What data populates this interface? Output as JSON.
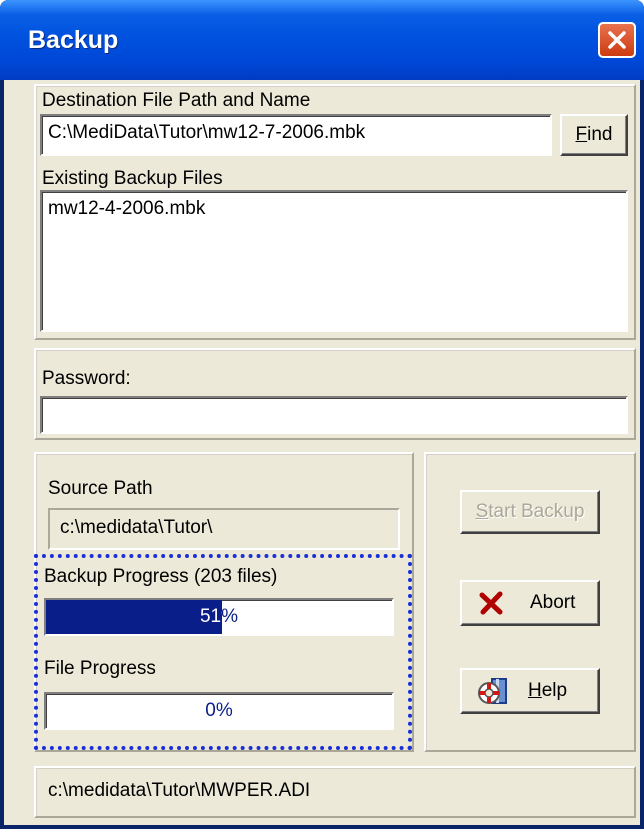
{
  "window": {
    "title": "Backup"
  },
  "destination": {
    "label": "Destination File Path and Name",
    "value": "C:\\MediData\\Tutor\\mw12-7-2006.mbk",
    "find_label_prefix": "",
    "find_hotkey": "F",
    "find_label_rest": "ind"
  },
  "existing": {
    "label": "Existing Backup Files",
    "files": [
      "mw12-4-2006.mbk"
    ]
  },
  "password": {
    "label": "Password:",
    "value": ""
  },
  "source": {
    "label": "Source Path",
    "value": "c:\\medidata\\Tutor\\"
  },
  "backup_progress": {
    "label": "Backup Progress (203 files)",
    "percent": 51,
    "text": "51%"
  },
  "file_progress": {
    "label": "File Progress",
    "percent": 0,
    "text": "0%"
  },
  "buttons": {
    "start_hotkey": "S",
    "start_rest": "tart Backup",
    "abort": "Abort",
    "help_hotkey": "H",
    "help_rest": "elp"
  },
  "status": {
    "text": "c:\\medidata\\Tutor\\MWPER.ADI"
  },
  "icons": {
    "close": "close-x-icon",
    "abort": "red-x-icon",
    "help": "lifebuoy-book-icon"
  },
  "colors": {
    "progress_fill": "#0a1e8a",
    "focus_border": "#1c2ed6",
    "dialog_bg": "#ece9d8"
  }
}
